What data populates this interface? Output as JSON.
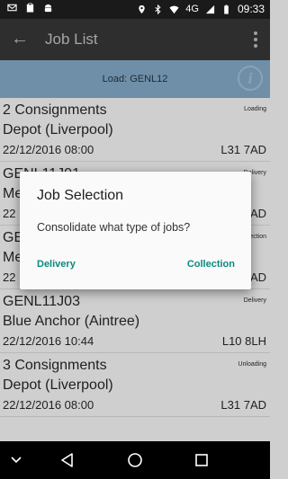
{
  "status": {
    "time": "09:33",
    "network": "4G"
  },
  "appbar": {
    "title": "Job List"
  },
  "load": {
    "label": "Load: GENL12"
  },
  "jobs": [
    {
      "ref": "2 Consignments",
      "type": "Loading",
      "name": "Depot (Liverpool)",
      "datetime": "22/12/2016 08:00",
      "postcode": "L31 7AD"
    },
    {
      "ref": "GENL11J01",
      "type": "Delivery",
      "name": "Me",
      "datetime": "22",
      "postcode": "AD"
    },
    {
      "ref": "GE",
      "type": "ection",
      "name": "Me",
      "datetime": "22",
      "postcode": "AD"
    },
    {
      "ref": "GENL11J03",
      "type": "Delivery",
      "name": "Blue Anchor (Aintree)",
      "datetime": "22/12/2016 10:44",
      "postcode": "L10 8LH"
    },
    {
      "ref": "3 Consignments",
      "type": "Unloading",
      "name": "Depot (Liverpool)",
      "datetime": "22/12/2016 08:00",
      "postcode": "L31 7AD"
    }
  ],
  "dialog": {
    "title": "Job Selection",
    "message": "Consolidate what type of jobs?",
    "btn_delivery": "Delivery",
    "btn_collection": "Collection"
  }
}
